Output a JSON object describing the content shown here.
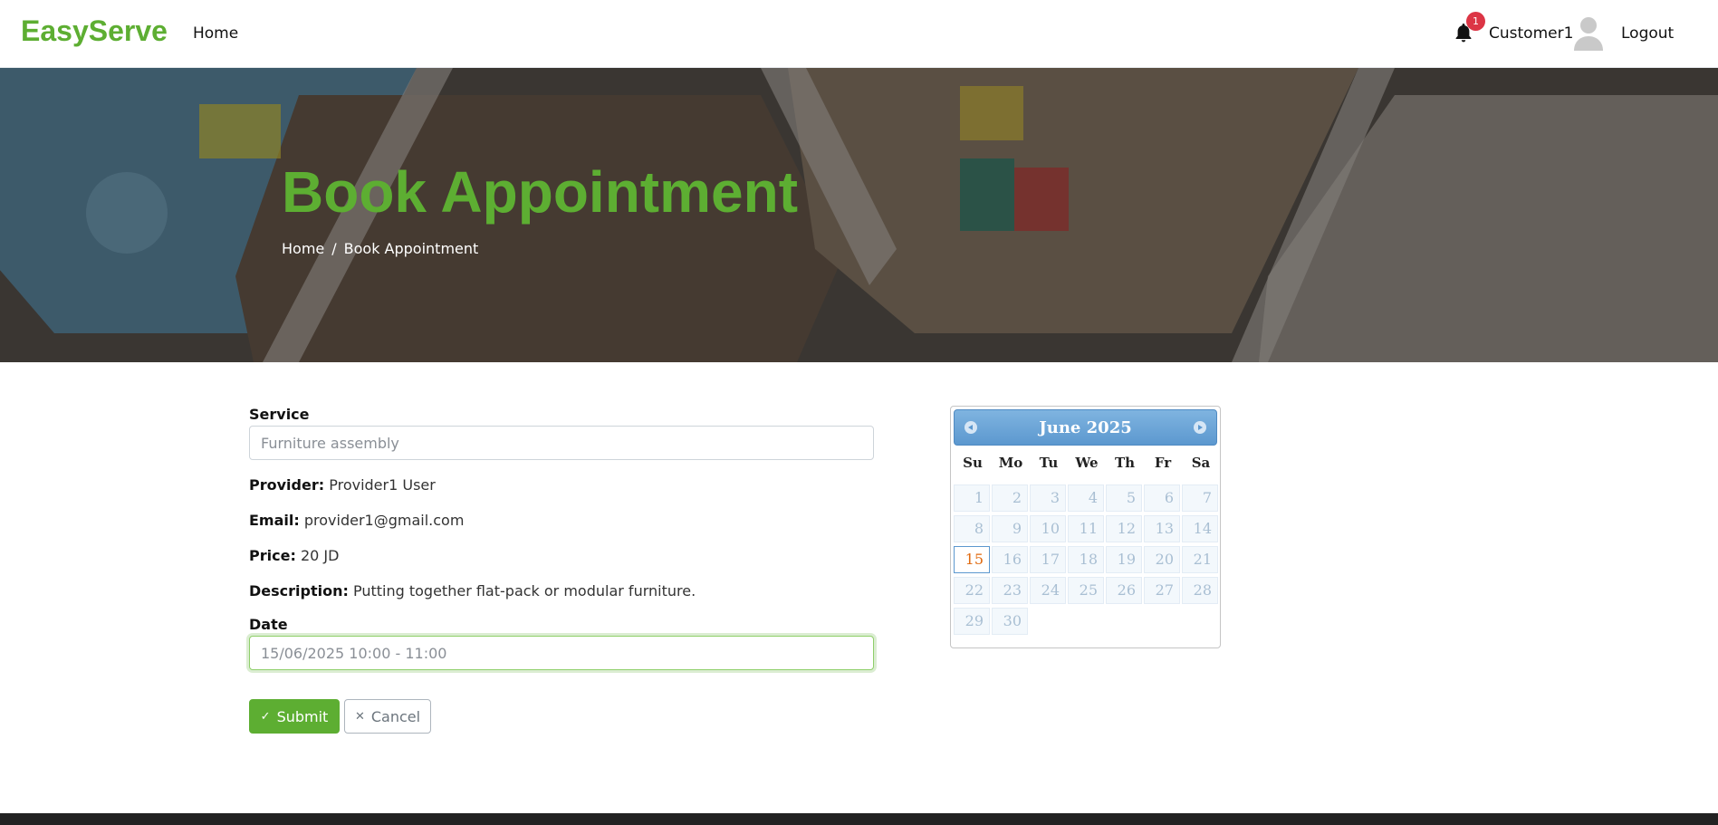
{
  "nav": {
    "brand": "EasyServe",
    "home_label": "Home",
    "notification_count": "1",
    "user_name": "Customer1",
    "logout_label": "Logout"
  },
  "hero": {
    "title": "Book Appointment",
    "breadcrumb": [
      "Home",
      "Book Appointment"
    ],
    "breadcrumb_separator": "/"
  },
  "form": {
    "service_label": "Service",
    "service_placeholder": "Furniture assembly",
    "provider_label": "Provider:",
    "provider_value": "Provider1 User",
    "email_label": "Email:",
    "email_value": "provider1@gmail.com",
    "price_label": "Price:",
    "price_value": "20 JD",
    "description_label": "Description:",
    "description_value": "Putting together flat-pack or modular furniture.",
    "date_label": "Date",
    "date_placeholder": "15/06/2025 10:00 - 11:00",
    "submit_label": "Submit",
    "cancel_label": "Cancel",
    "submit_icon": "check-icon",
    "cancel_icon": "close-icon"
  },
  "datepicker": {
    "month": "June",
    "year": "2025",
    "weekdays": [
      "Su",
      "Mo",
      "Tu",
      "We",
      "Th",
      "Fr",
      "Sa"
    ],
    "days": [
      "1",
      "2",
      "3",
      "4",
      "5",
      "6",
      "7",
      "8",
      "9",
      "10",
      "11",
      "12",
      "13",
      "14",
      "15",
      "16",
      "17",
      "18",
      "19",
      "20",
      "21",
      "22",
      "23",
      "24",
      "25",
      "26",
      "27",
      "28",
      "29",
      "30"
    ],
    "today": "15",
    "prev_icon": "circle-arrow-left-icon",
    "next_icon": "circle-arrow-right-icon"
  },
  "colors": {
    "brand_green": "#5dae32",
    "danger_badge": "#dc3545",
    "datepicker_header": "#5c98cf",
    "today_text": "#e06a10"
  }
}
